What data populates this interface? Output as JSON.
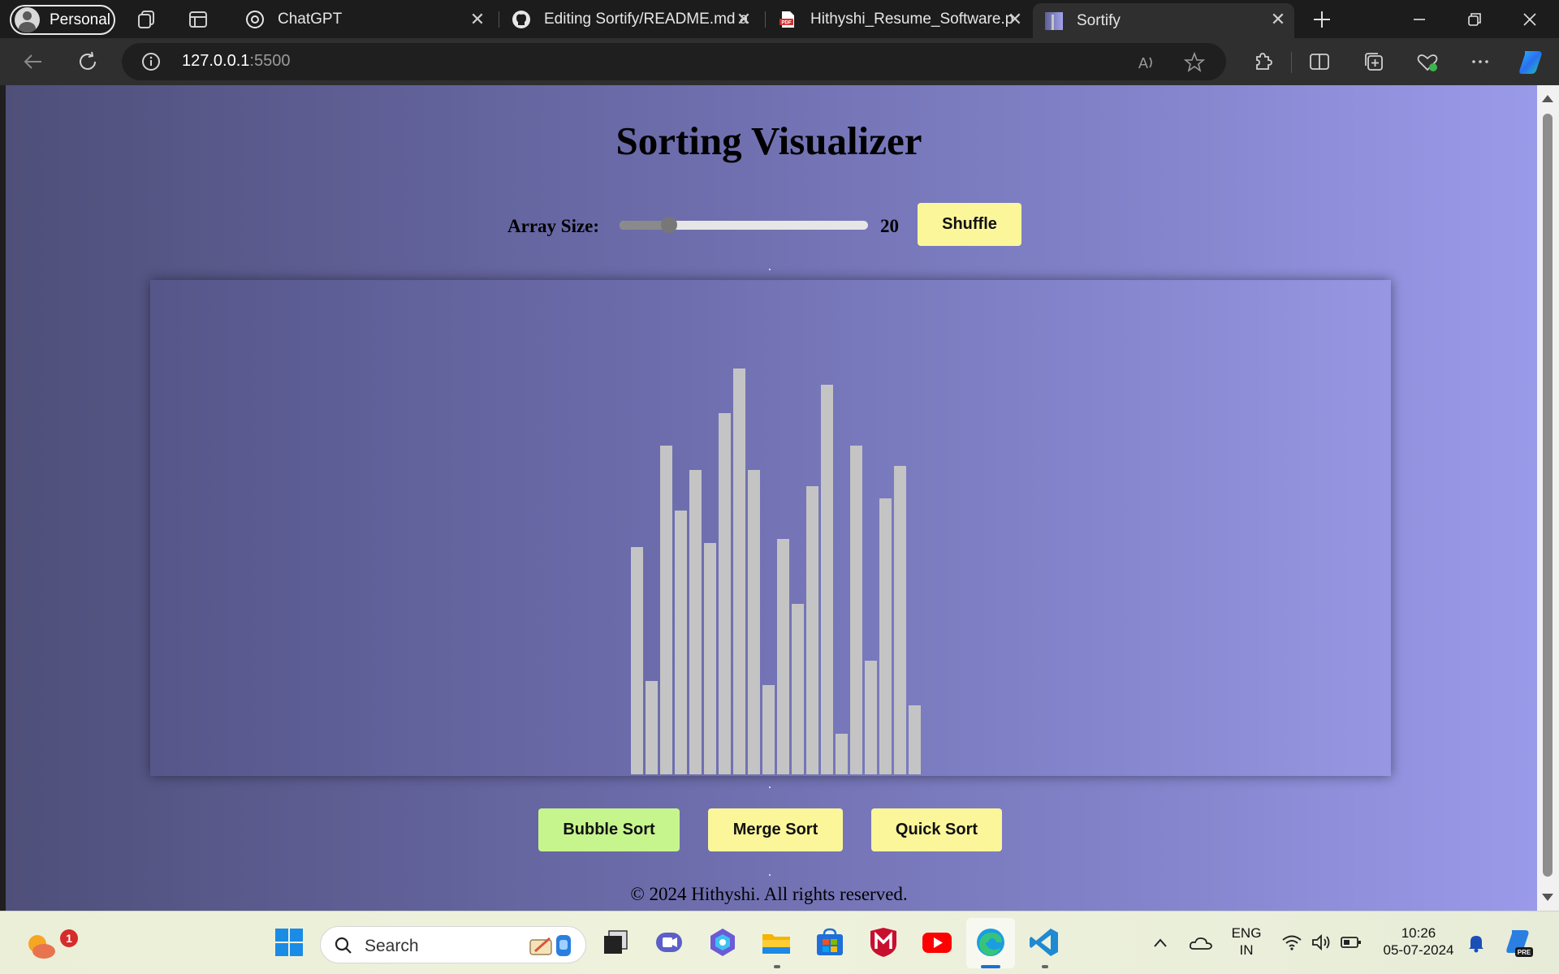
{
  "browser": {
    "profile_label": "Personal",
    "tabs": [
      {
        "label": "ChatGPT",
        "icon": "chatgpt-icon"
      },
      {
        "label": "Editing Sortify/README.md a",
        "icon": "github-icon"
      },
      {
        "label": "Hithyshi_Resume_Software.p",
        "icon": "pdf-icon"
      },
      {
        "label": "Sortify",
        "icon": "sortify-icon",
        "active": true
      }
    ],
    "url_host": "127.0.0.1",
    "url_port": ":5500"
  },
  "page": {
    "title": "Sorting Visualizer",
    "array_size_label": "Array Size:",
    "array_size_value": "20",
    "array_size_fraction": 0.2,
    "shuffle_label": "Shuffle",
    "buttons": {
      "bubble": "Bubble Sort",
      "merge": "Merge Sort",
      "quick": "Quick Sort"
    },
    "footer": "© 2024 Hithyshi. All rights reserved.",
    "bar_color": "#c4c4c4",
    "bars": [
      56,
      23,
      81,
      65,
      75,
      57,
      89,
      100,
      75,
      22,
      58,
      42,
      71,
      96,
      10,
      81,
      28,
      68,
      76,
      17
    ]
  },
  "taskbar": {
    "search_placeholder": "Search",
    "weather_badge": "1",
    "lang_top": "ENG",
    "lang_bottom": "IN",
    "time": "10:26",
    "date": "05-07-2024"
  }
}
